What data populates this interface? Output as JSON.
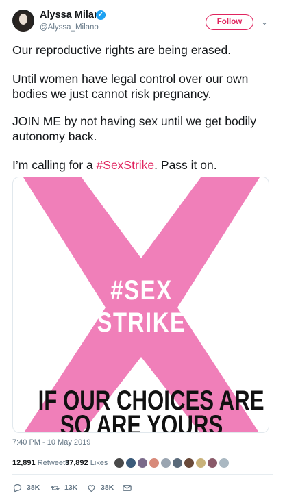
{
  "author": {
    "name": "Alyssa Milano",
    "handle": "@Alyssa_Milano",
    "verified_icon": "✓"
  },
  "follow_label": "Follow",
  "chevron_icon": "⌄",
  "tweet": {
    "line1": "Our reproductive rights are being erased.",
    "line2": "Until women have legal control over our own bodies we just cannot risk pregnancy.",
    "line3": "JOIN ME by not having sex until we get bodily autonomy back.",
    "line4_before": "I’m calling for a ",
    "line4_hashtag": "#SexStrike",
    "line4_after": ". Pass it on."
  },
  "media": {
    "title_line1": "#SEX",
    "title_line2": "STRIKE",
    "tagline_line1": "IF OUR CHOICES ARE DENIED,",
    "tagline_line2": "SO ARE YOURS",
    "x_color": "#f07fb9"
  },
  "timestamp": "7:40 PM - 10 May 2019",
  "stats": {
    "retweets_count": "12,891",
    "retweets_label": "Retweets",
    "likes_count": "37,892",
    "likes_label": "Likes"
  },
  "liker_colors": [
    "#4a4a4a",
    "#3b5b7a",
    "#7a6a8a",
    "#d88a7a",
    "#9aa5b1",
    "#5a6a7a",
    "#6a4a3a",
    "#c9b27a",
    "#8a5a6a",
    "#aab8c2"
  ],
  "actions": {
    "reply_count": "38K",
    "retweet_count": "13K",
    "like_count": "38K"
  },
  "colors": {
    "accent": "#e0245e",
    "verified": "#1da1f2",
    "muted": "#657786"
  }
}
